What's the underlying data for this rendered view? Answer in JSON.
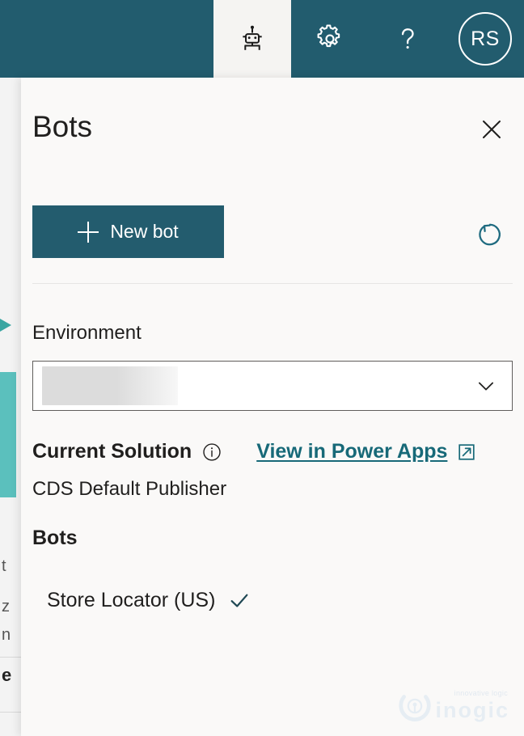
{
  "topbar": {
    "background_color": "#225c6e",
    "items": [
      {
        "name": "bots-icon",
        "label": "Bots",
        "active": true
      },
      {
        "name": "settings-icon",
        "label": "Settings",
        "active": false
      },
      {
        "name": "help-icon",
        "label": "Help",
        "active": false
      }
    ],
    "avatar": {
      "initials": "RS",
      "label": "Account manager"
    }
  },
  "panel": {
    "title": "Bots",
    "close_label": "Close",
    "new_bot_label": "New bot",
    "refresh_label": "Refresh",
    "environment": {
      "label": "Environment",
      "selected_value": "",
      "redacted": true
    },
    "solution": {
      "label": "Current Solution",
      "info_label": "More information",
      "link_label": "View in Power Apps",
      "value": "CDS Default Publisher"
    },
    "bots_section": {
      "heading": "Bots",
      "items": [
        {
          "name": "Store Locator (US)",
          "selected": true
        }
      ]
    }
  },
  "watermark": {
    "tagline": "innovative logic",
    "word": "inogic"
  },
  "background": {
    "text_fragments": [
      "t",
      "z",
      "n",
      "e"
    ]
  },
  "colors": {
    "brand_teal": "#225c6e",
    "button_teal": "#235c6e",
    "link_teal": "#176978",
    "panel_bg": "#faf9f8",
    "accent_aqua": "#5bc0bd",
    "text_primary": "#201f1e"
  }
}
